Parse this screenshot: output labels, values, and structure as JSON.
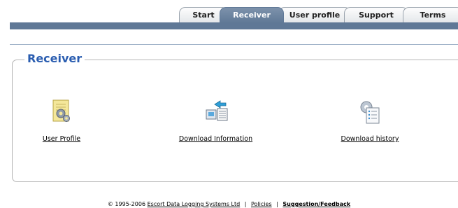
{
  "tabs": [
    {
      "label": "Start",
      "active": false
    },
    {
      "label": "Receiver",
      "active": true
    },
    {
      "label": "User profile",
      "active": false
    },
    {
      "label": "Support",
      "active": false
    },
    {
      "label": "Terms",
      "active": false
    }
  ],
  "colors": {
    "tab_active": "#5f7896",
    "legend": "#2a5db0",
    "panel_border": "#b5b5b5"
  },
  "panel": {
    "title": "Receiver",
    "items": [
      {
        "label": "User Profile",
        "icon": "user-profile-gear-icon"
      },
      {
        "label": "Download Information",
        "icon": "download-information-icon"
      },
      {
        "label": "Download history",
        "icon": "download-history-icon"
      }
    ]
  },
  "footer": {
    "copyright": "© 1995-2006",
    "company_link": "Escort Data Logging Systems Ltd",
    "sep1": "|",
    "policies_link": "Policies",
    "sep2": "|",
    "feedback_link": "Suggestion/Feedback"
  }
}
